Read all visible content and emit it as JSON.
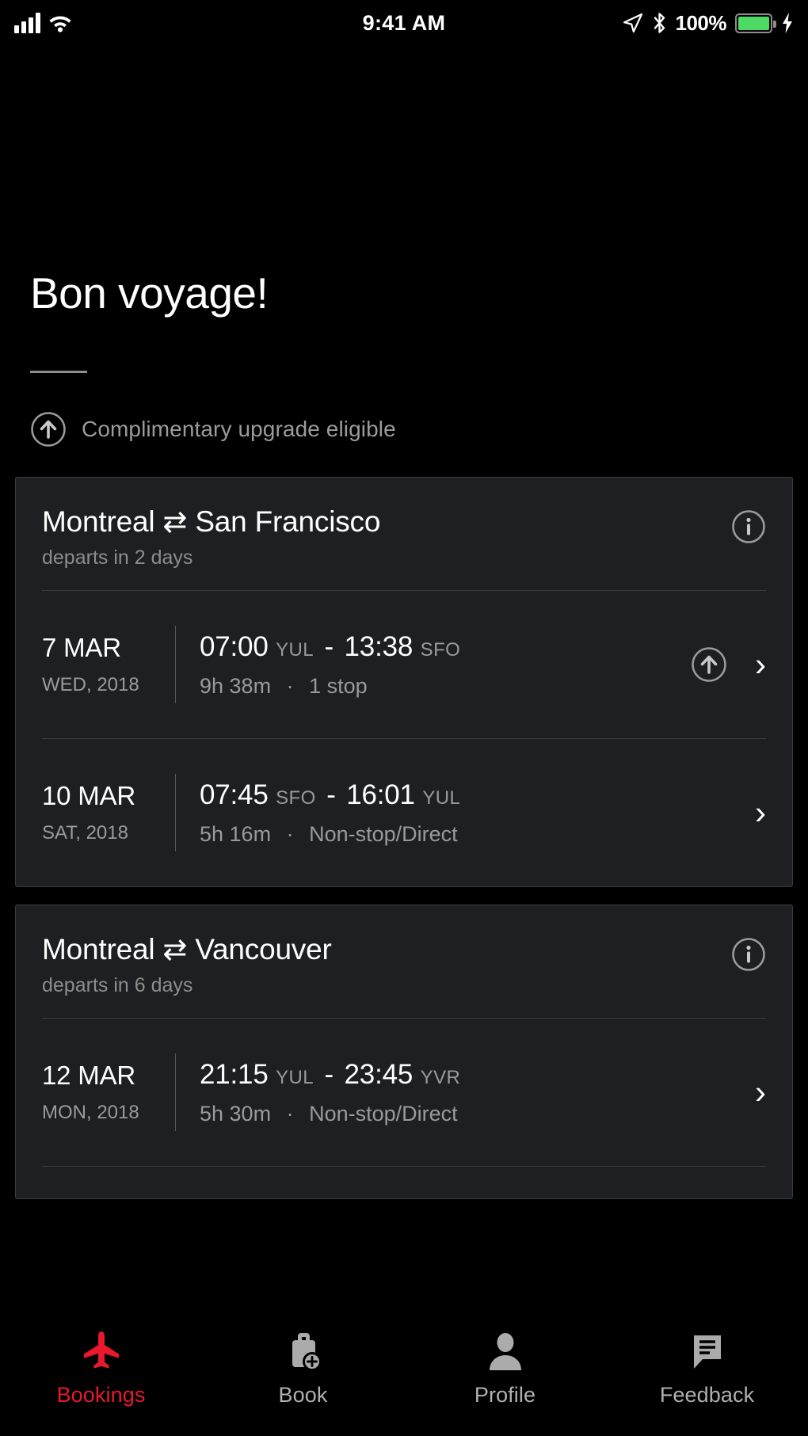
{
  "status_bar": {
    "time": "9:41 AM",
    "battery_percent": "100%",
    "icons": [
      "signal-bars-icon",
      "wifi-icon",
      "location-arrow-icon",
      "bluetooth-icon",
      "battery-icon",
      "charging-bolt-icon"
    ]
  },
  "header": {
    "title": "Bon voyage!",
    "legend": {
      "icon": "circle-up-arrow-icon",
      "label": "Complimentary upgrade eligible"
    }
  },
  "colors": {
    "background": "#000000",
    "card_background": "#1d1f22",
    "card_border": "#3a3c40",
    "accent_red": "#e8192c",
    "muted_text": "#9a9a9a",
    "primary_text": "#ffffff"
  },
  "bookings": [
    {
      "origin": "Montreal",
      "swap_icon": "⇄",
      "destination": "San Francisco",
      "route": "Montreal ⇄ San Francisco",
      "departs": "departs in 2 days",
      "info_icon": "info-circle-icon",
      "flights": [
        {
          "date": "7 MAR",
          "weekday_year": "WED, 2018",
          "depart_time": "07:00",
          "depart_code": "YUL",
          "separator": "-",
          "arrive_time": "13:38",
          "arrive_code": "SFO",
          "duration": "9h 38m",
          "dot": "·",
          "stops": "1 stop",
          "upgrade_eligible": true,
          "chevron": "›"
        },
        {
          "date": "10 MAR",
          "weekday_year": "SAT, 2018",
          "depart_time": "07:45",
          "depart_code": "SFO",
          "separator": "-",
          "arrive_time": "16:01",
          "arrive_code": "YUL",
          "duration": "5h 16m",
          "dot": "·",
          "stops": "Non-stop/Direct",
          "upgrade_eligible": false,
          "chevron": "›"
        }
      ]
    },
    {
      "origin": "Montreal",
      "swap_icon": "⇄",
      "destination": "Vancouver",
      "route": "Montreal ⇄ Vancouver",
      "departs": "departs in 6 days",
      "info_icon": "info-circle-icon",
      "flights": [
        {
          "date": "12 MAR",
          "weekday_year": "MON, 2018",
          "depart_time": "21:15",
          "depart_code": "YUL",
          "separator": "-",
          "arrive_time": "23:45",
          "arrive_code": "YVR",
          "duration": "5h 30m",
          "dot": "·",
          "stops": "Non-stop/Direct",
          "upgrade_eligible": false,
          "chevron": "›"
        }
      ]
    }
  ],
  "tab_bar": {
    "items": [
      {
        "label": "Bookings",
        "icon": "airplane-icon",
        "active": true
      },
      {
        "label": "Book",
        "icon": "briefcase-plus-icon",
        "active": false
      },
      {
        "label": "Profile",
        "icon": "person-icon",
        "active": false
      },
      {
        "label": "Feedback",
        "icon": "chat-bubble-icon",
        "active": false
      }
    ]
  }
}
